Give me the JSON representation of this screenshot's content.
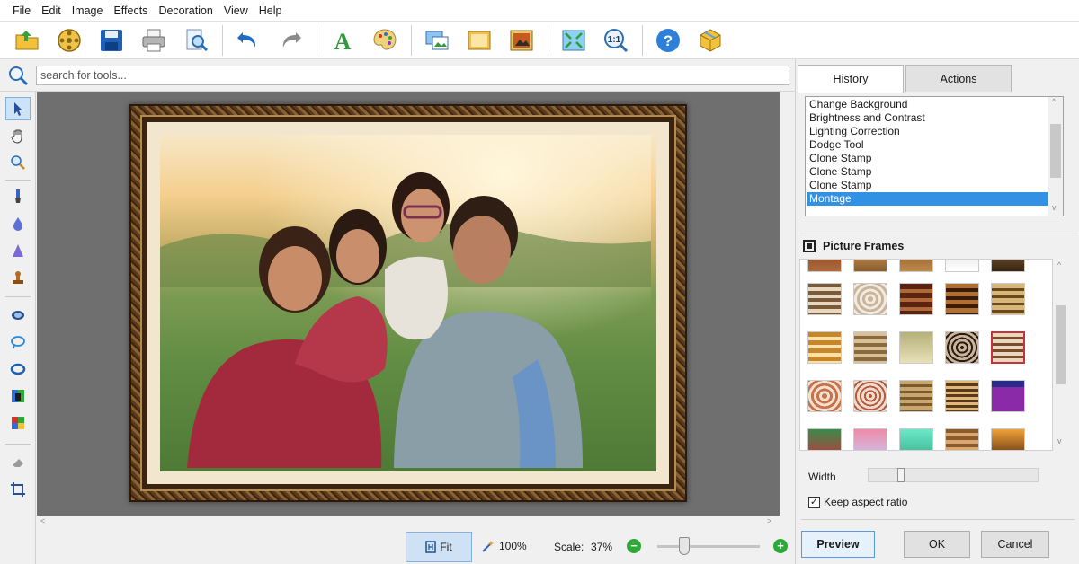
{
  "menubar": {
    "items": [
      "File",
      "Edit",
      "Image",
      "Effects",
      "Decoration",
      "View",
      "Help"
    ]
  },
  "toolbar": {
    "buttons": [
      "open-icon",
      "film-reel-icon",
      "save-icon",
      "print-icon",
      "zoom-page-icon",
      "undo-icon",
      "redo-icon",
      "text-icon",
      "palette-icon",
      "resize-image-icon",
      "crop-image-icon",
      "adjust-image-icon",
      "fit-screen-icon",
      "actual-size-icon",
      "help-icon",
      "package-icon"
    ],
    "actual_size_label": "1:1",
    "text_label": "A"
  },
  "search": {
    "placeholder": "search for tools..."
  },
  "tools": [
    "pointer-icon",
    "hand-icon",
    "magnifier-icon",
    "brush-icon",
    "drop-icon",
    "cone-icon",
    "stamp-icon",
    "eye-icon",
    "lasso-icon",
    "selection-icon",
    "color-balance-icon",
    "recolor-icon",
    "eraser-icon",
    "crop-icon"
  ],
  "status": {
    "fit_label": "Fit",
    "zoom_label": "100%",
    "scale_label": "Scale:",
    "scale_value": "37%",
    "scale_fraction": 0.26
  },
  "panel": {
    "tabs": [
      "History",
      "Actions"
    ],
    "history": [
      "Change Background",
      "Brightness and Contrast",
      "Lighting Correction",
      "Dodge Tool",
      "Clone Stamp",
      "Clone Stamp",
      "Clone Stamp",
      "Montage"
    ],
    "history_selected": 7,
    "frames_title": "Picture Frames",
    "width_label": "Width",
    "keep_aspect_label": "Keep aspect ratio",
    "keep_aspect_checked": true,
    "preview_label": "Preview",
    "ok_label": "OK",
    "cancel_label": "Cancel"
  },
  "colors": {
    "accent": "#3391e3",
    "selection": "#c8323c"
  }
}
